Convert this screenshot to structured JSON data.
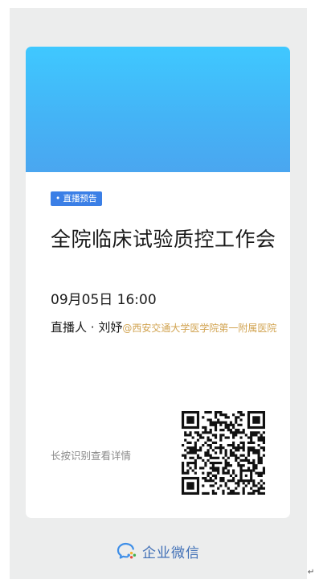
{
  "card": {
    "badge": "• 直播预告",
    "title": "全院临床试验质控工作会",
    "datetime": "09月05日 16:00",
    "host_label": "直播人 · ",
    "host_name": "刘妤",
    "host_org": "@西安交通大学医学院第一附属医院",
    "hint": "长按识别查看详情"
  },
  "footer": {
    "brand": "企业微信"
  },
  "icons": {
    "qr": "qr-code",
    "brand": "wecom-logo-icon",
    "paragraph": "return-mark-icon"
  },
  "colors": {
    "banner_top": "#3fc8ff",
    "banner_bottom": "#4aa6f0",
    "badge": "#3b7fe6",
    "org_text": "#d1a350",
    "brand": "#3f6fb6"
  },
  "paragraph_mark": "↵"
}
